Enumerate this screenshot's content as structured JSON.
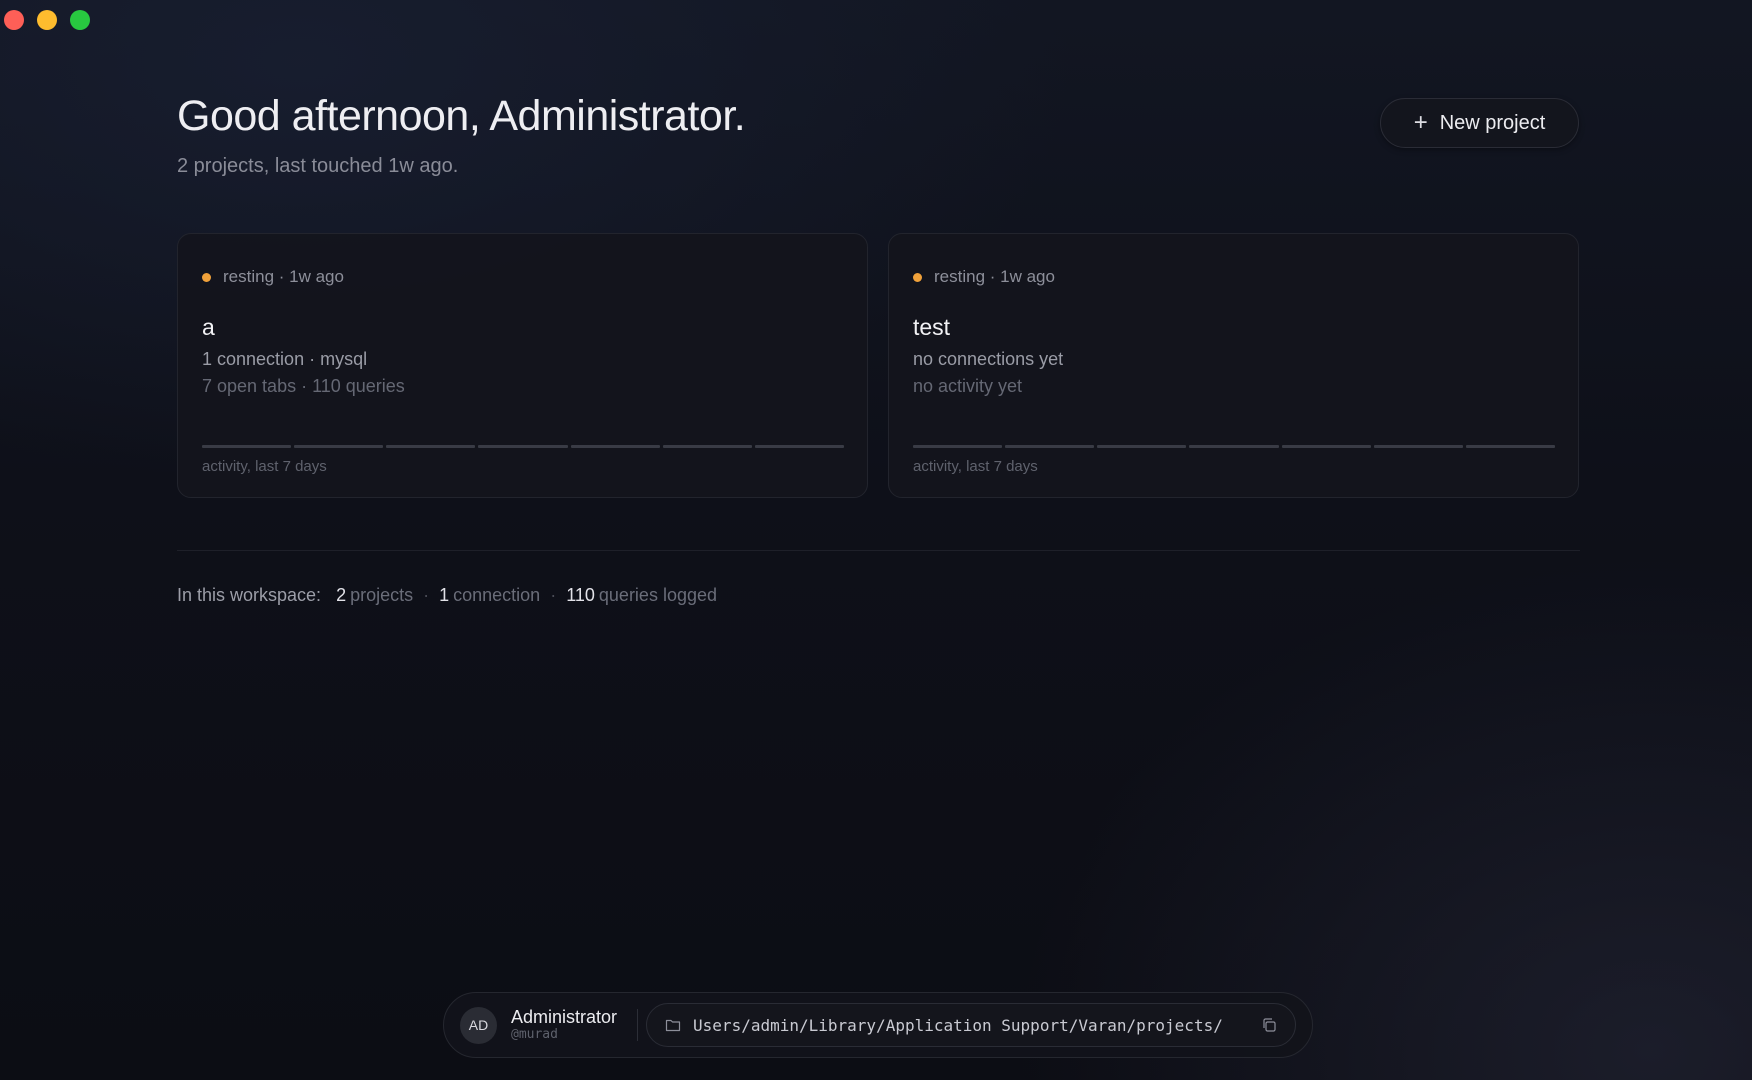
{
  "window_controls": {
    "close": "close",
    "minimize": "minimize",
    "zoom": "zoom"
  },
  "header": {
    "greeting": "Good afternoon, Administrator.",
    "subline": "2 projects, last touched 1w ago.",
    "new_project_label": "New project",
    "new_project_icon": "plus-icon"
  },
  "projects": [
    {
      "status": "resting · 1w ago",
      "name": "a",
      "line1": "1 connection · mysql",
      "line2": "7 open tabs · 110 queries",
      "activity_label": "activity, last 7 days",
      "activity_days": [
        0,
        0,
        0,
        0,
        0,
        0,
        0
      ]
    },
    {
      "status": "resting · 1w ago",
      "name": "test",
      "line1": "no connections yet",
      "line2": "no activity yet",
      "activity_label": "activity, last 7 days",
      "activity_days": [
        0,
        0,
        0,
        0,
        0,
        0,
        0
      ]
    }
  ],
  "workspace": {
    "lead": "In this workspace:",
    "projects_num": "2",
    "projects_unit": "projects",
    "connections_num": "1",
    "connections_unit": "connection",
    "queries_num": "110",
    "queries_unit": "queries logged",
    "separator": "·"
  },
  "footer": {
    "avatar_initials": "AD",
    "user_name": "Administrator",
    "user_handle": "@murad",
    "path": "Users/admin/Library/Application Support/Varan/projects/",
    "folder_icon": "folder-icon",
    "copy_icon": "copy-icon"
  },
  "colors": {
    "status_dot": "#f0a13a",
    "background": "#0e1019",
    "card": "#14151c"
  }
}
